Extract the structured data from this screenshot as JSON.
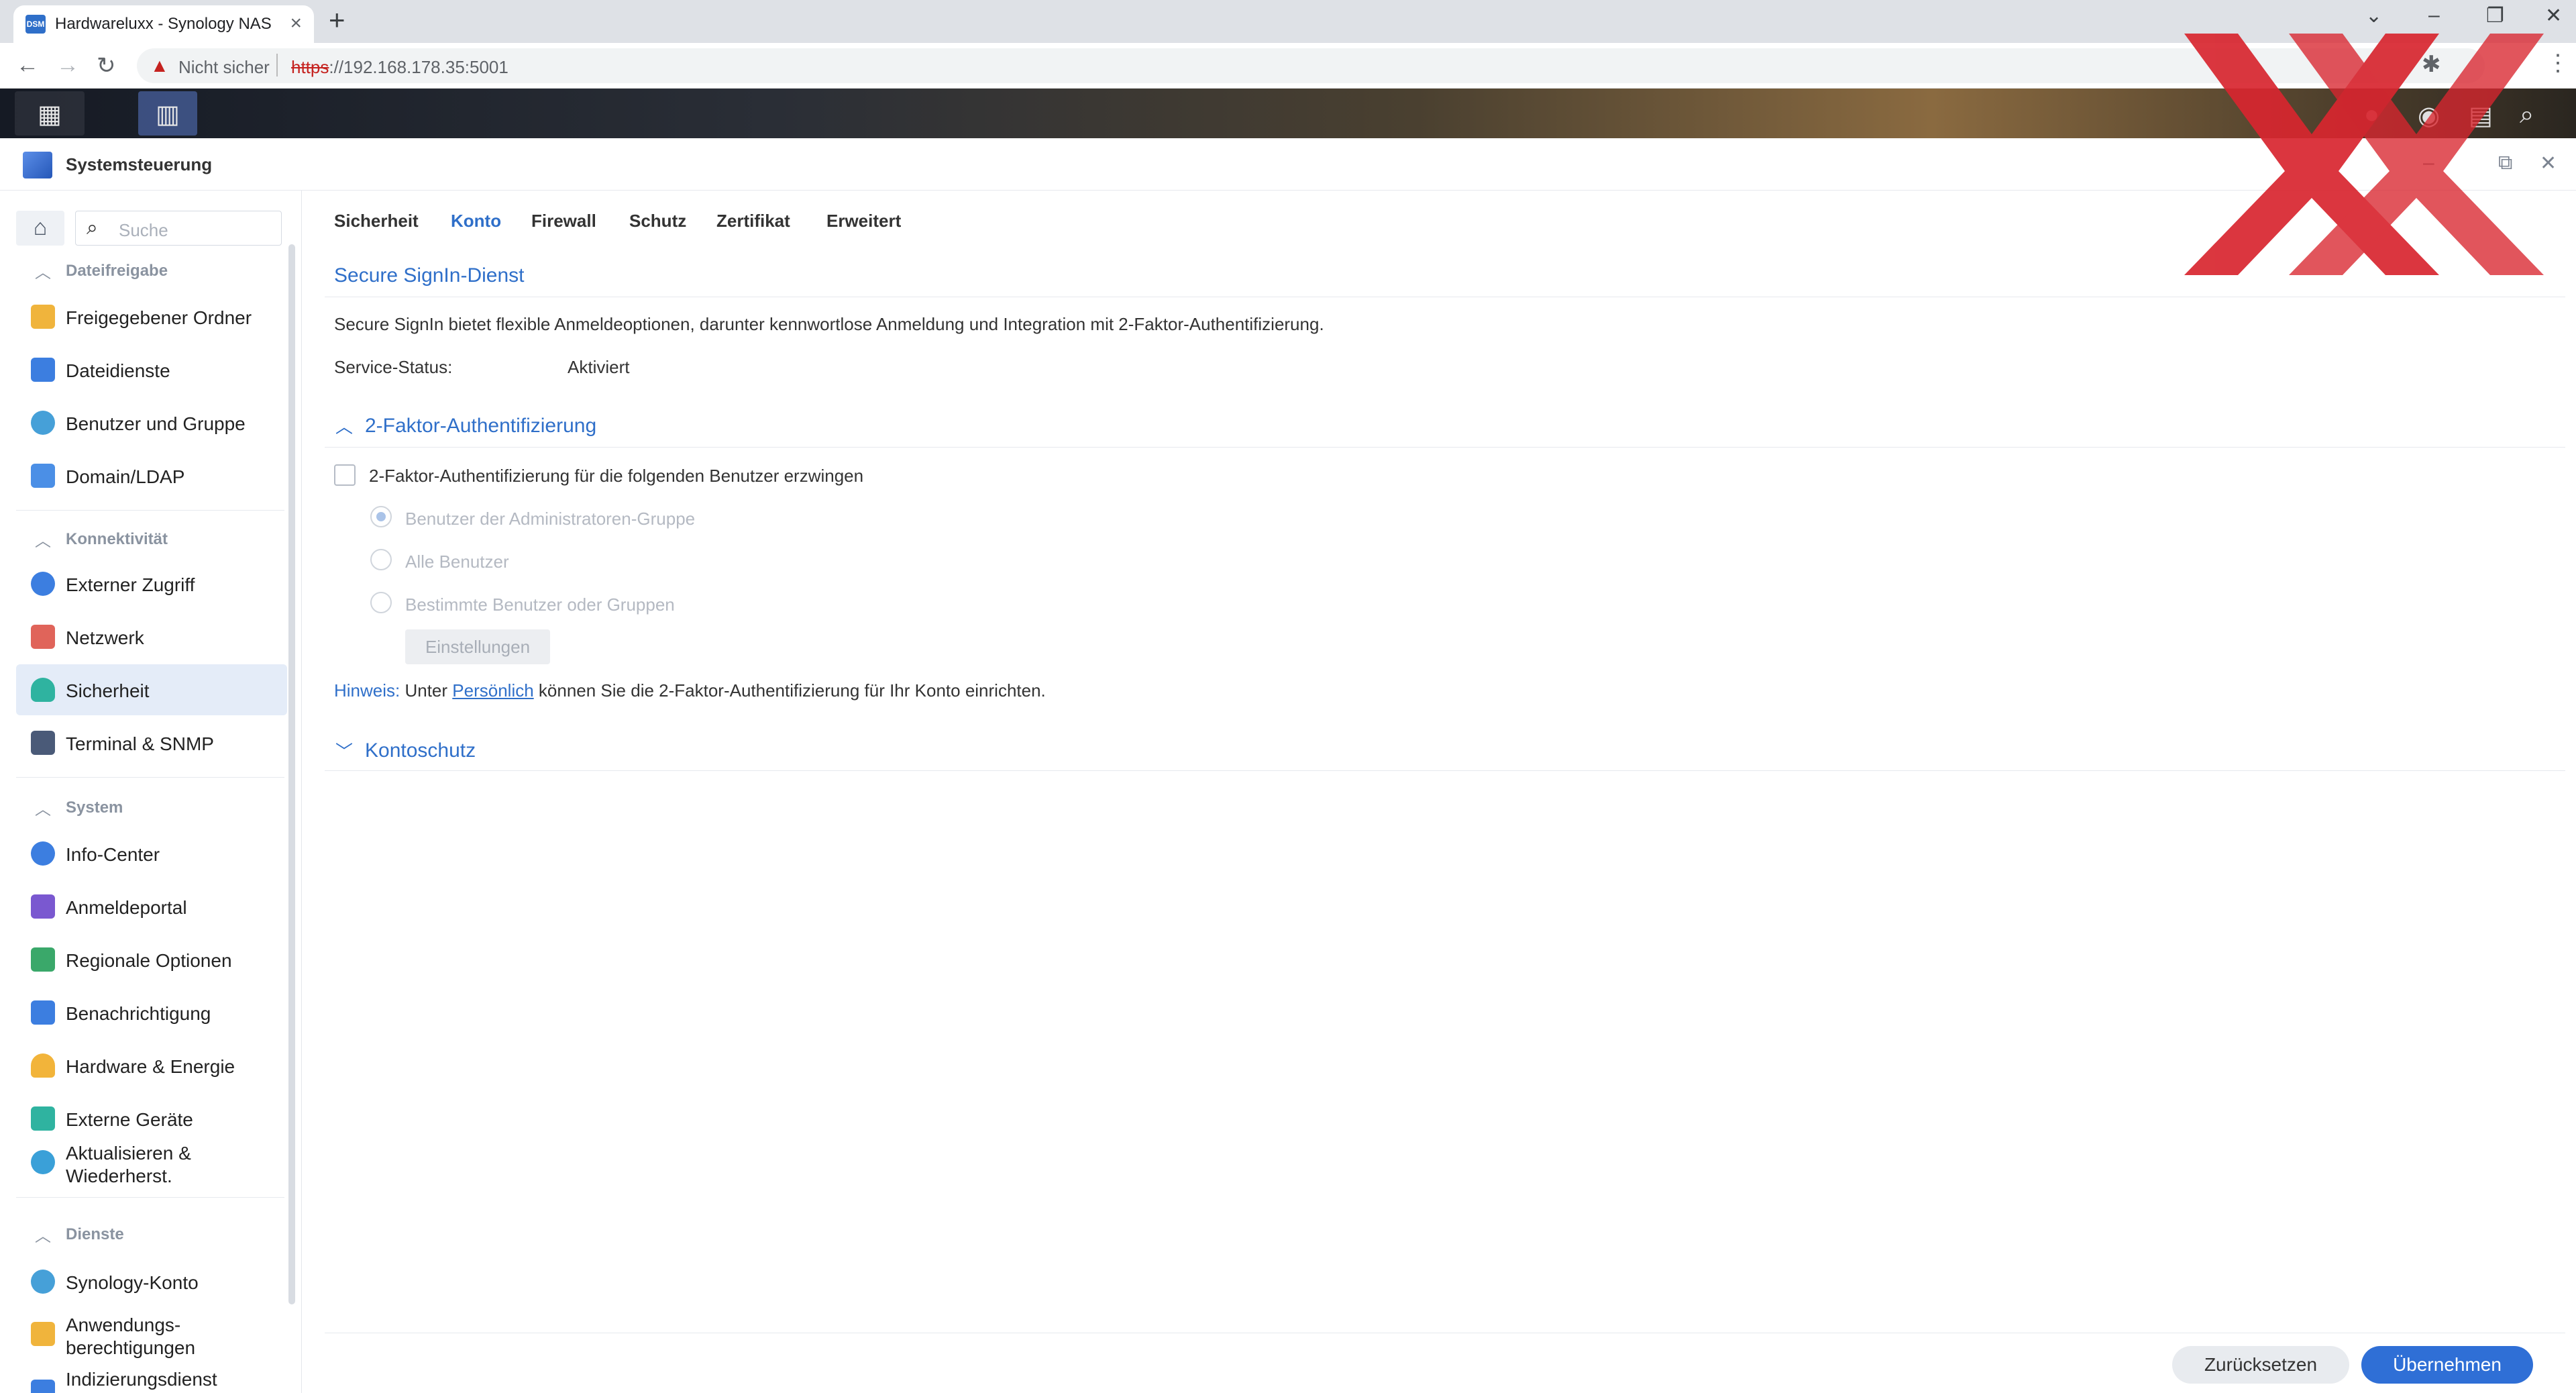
{
  "browser": {
    "tab_title": "Hardwareluxx - Synology NAS",
    "favicon_text": "DSM",
    "not_secure": "Nicht sicher",
    "url_scheme": "https",
    "url_rest": "://192.168.178.35:5001"
  },
  "window": {
    "title": "Systemsteuerung"
  },
  "sidebar": {
    "search_placeholder": "Suche",
    "sections": [
      {
        "label": "Dateifreigabe",
        "items": [
          "Freigegebener Ordner",
          "Dateidienste",
          "Benutzer und Gruppe",
          "Domain/LDAP"
        ]
      },
      {
        "label": "Konnektivität",
        "items": [
          "Externer Zugriff",
          "Netzwerk",
          "Sicherheit",
          "Terminal & SNMP"
        ]
      },
      {
        "label": "System",
        "items": [
          "Info-Center",
          "Anmeldeportal",
          "Regionale Optionen",
          "Benachrichtigung",
          "Hardware & Energie",
          "Externe Geräte",
          "Aktualisieren & Wiederherst."
        ]
      },
      {
        "label": "Dienste",
        "items": [
          "Synology-Konto",
          "Anwendungs-berechtigungen",
          "Indizierungsdienst"
        ]
      }
    ],
    "active_item": "Sicherheit"
  },
  "tabs": [
    "Sicherheit",
    "Konto",
    "Firewall",
    "Schutz",
    "Zertifikat",
    "Erweitert"
  ],
  "active_tab": "Konto",
  "content": {
    "signin_title": "Secure SignIn-Dienst",
    "signin_desc": "Secure SignIn bietet flexible Anmeldeoptionen, darunter kennwortlose Anmeldung und Integration mit 2-Faktor-Authentifizierung.",
    "status_label": "Service-Status:",
    "status_value": "Aktiviert",
    "twofa_title": "2-Faktor-Authentifizierung",
    "twofa_enforce": "2-Faktor-Authentifizierung für die folgenden Benutzer erzwingen",
    "radio_admins": "Benutzer der Administratoren-Gruppe",
    "radio_all": "Alle Benutzer",
    "radio_specific": "Bestimmte Benutzer oder Gruppen",
    "settings_button": "Einstellungen",
    "hint_key": "Hinweis:",
    "hint_pre": " Unter ",
    "hint_link": "Persönlich",
    "hint_post": " können Sie die 2-Faktor-Authentifizierung für Ihr Konto einrichten.",
    "account_protection_title": "Kontoschutz"
  },
  "footer": {
    "reset": "Zurücksetzen",
    "apply": "Übernehmen"
  },
  "colors": {
    "accent": "#2f6fc9",
    "apply_button": "#2f6fd6",
    "active_item_bg": "#e4ecf8",
    "logo_red": "#d8262f"
  }
}
